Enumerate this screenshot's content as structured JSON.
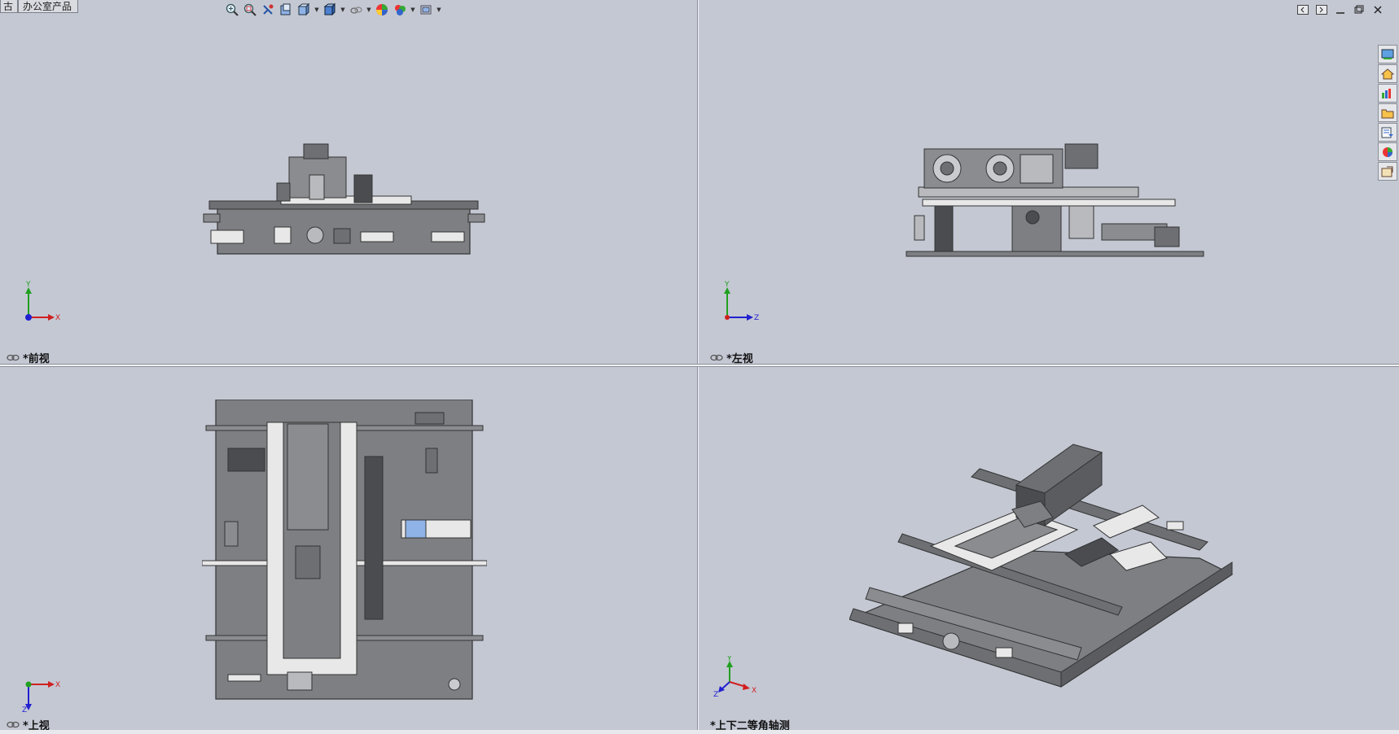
{
  "tabs": [
    "古",
    "办公室产品"
  ],
  "toolbar": {
    "icons": [
      "zoom-to-fit-icon",
      "zoom-area-icon",
      "previous-view-icon",
      "section-view-icon",
      "view-orientation-icon",
      "display-style-icon",
      "hide-show-icon",
      "edit-appearance-icon",
      "apply-scene-icon",
      "view-settings-icon"
    ]
  },
  "viewports": {
    "front": {
      "label": "*前视",
      "triad_axes": [
        "Y",
        "X"
      ]
    },
    "left": {
      "label": "*左视",
      "triad_axes": [
        "Y",
        "Z"
      ]
    },
    "top": {
      "label": "*上视",
      "triad_axes": [
        "X",
        "Z"
      ]
    },
    "iso": {
      "label": "*上下二等角轴测",
      "triad_axes": [
        "Y",
        "Z",
        "X"
      ]
    }
  },
  "task_pane": [
    "solidworks-resources-icon",
    "design-library-icon",
    "file-explorer-icon",
    "view-palette-icon",
    "appearances-icon",
    "custom-properties-icon",
    "file-folder-icon"
  ],
  "colors": {
    "background": "#c4c8d3",
    "model": "#7d7f83",
    "model_dark": "#4a4c50",
    "model_light": "#e8e8e8",
    "axis_x": "#d02020",
    "axis_y": "#20a020",
    "axis_z": "#2020d0"
  }
}
